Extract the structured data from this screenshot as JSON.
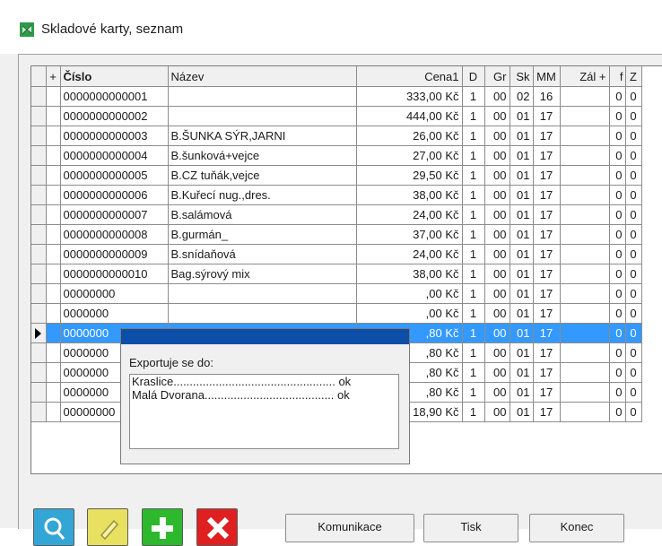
{
  "window": {
    "title": "Skladové karty, seznam",
    "icon": "stock-list-icon"
  },
  "grid": {
    "columns": {
      "plus": "+",
      "cislo": "Číslo",
      "nazev": "Název",
      "cena1": "Cena1",
      "d": "D",
      "gr": "Gr",
      "sk": "Sk",
      "mm": "MM",
      "zal": "Zál +",
      "f": "f",
      "z": "Z"
    },
    "rows": [
      {
        "cislo": "0000000000001",
        "nazev": "",
        "cena": "333,00 Kč",
        "d": "1",
        "gr": "00",
        "sk": "02",
        "mm": "16",
        "zal": "",
        "f": "0",
        "z": "0"
      },
      {
        "cislo": "0000000000002",
        "nazev": "",
        "cena": "444,00 Kč",
        "d": "1",
        "gr": "00",
        "sk": "01",
        "mm": "17",
        "zal": "",
        "f": "0",
        "z": "0"
      },
      {
        "cislo": "0000000000003",
        "nazev": "B.ŠUNKA SÝR,JARNI",
        "cena": "26,00 Kč",
        "d": "1",
        "gr": "00",
        "sk": "01",
        "mm": "17",
        "zal": "",
        "f": "0",
        "z": "0"
      },
      {
        "cislo": "0000000000004",
        "nazev": "B.šunková+vejce",
        "cena": "27,00 Kč",
        "d": "1",
        "gr": "00",
        "sk": "01",
        "mm": "17",
        "zal": "",
        "f": "0",
        "z": "0"
      },
      {
        "cislo": "0000000000005",
        "nazev": "B.CZ tuňák,vejce",
        "cena": "29,50 Kč",
        "d": "1",
        "gr": "00",
        "sk": "01",
        "mm": "17",
        "zal": "",
        "f": "0",
        "z": "0"
      },
      {
        "cislo": "0000000000006",
        "nazev": "B.Kuřecí nug.,dres.",
        "cena": "38,00 Kč",
        "d": "1",
        "gr": "00",
        "sk": "01",
        "mm": "17",
        "zal": "",
        "f": "0",
        "z": "0"
      },
      {
        "cislo": "0000000000007",
        "nazev": "B.salámová",
        "cena": "24,00 Kč",
        "d": "1",
        "gr": "00",
        "sk": "01",
        "mm": "17",
        "zal": "",
        "f": "0",
        "z": "0"
      },
      {
        "cislo": "0000000000008",
        "nazev": "B.gurmán_",
        "cena": "37,00 Kč",
        "d": "1",
        "gr": "00",
        "sk": "01",
        "mm": "17",
        "zal": "",
        "f": "0",
        "z": "0"
      },
      {
        "cislo": "0000000000009",
        "nazev": "B.snídaňová",
        "cena": "24,00 Kč",
        "d": "1",
        "gr": "00",
        "sk": "01",
        "mm": "17",
        "zal": "",
        "f": "0",
        "z": "0"
      },
      {
        "cislo": "0000000000010",
        "nazev": "Bag.sýrový mix",
        "cena": "38,00 Kč",
        "d": "1",
        "gr": "00",
        "sk": "01",
        "mm": "17",
        "zal": "",
        "f": "0",
        "z": "0"
      },
      {
        "cislo": "00000000",
        "nazev": "",
        "cena": ",00 Kč",
        "d": "1",
        "gr": "00",
        "sk": "01",
        "mm": "17",
        "zal": "",
        "f": "0",
        "z": "0"
      },
      {
        "cislo": "0000000",
        "nazev": "",
        "cena": ",00 Kč",
        "d": "1",
        "gr": "00",
        "sk": "01",
        "mm": "17",
        "zal": "",
        "f": "0",
        "z": "0"
      },
      {
        "cislo": "0000000",
        "nazev": "",
        "cena": ",80 Kč",
        "d": "1",
        "gr": "00",
        "sk": "01",
        "mm": "17",
        "zal": "",
        "f": "0",
        "z": "0"
      },
      {
        "cislo": "0000000",
        "nazev": "",
        "cena": ",80 Kč",
        "d": "1",
        "gr": "00",
        "sk": "01",
        "mm": "17",
        "zal": "",
        "f": "0",
        "z": "0"
      },
      {
        "cislo": "0000000",
        "nazev": "",
        "cena": ",80 Kč",
        "d": "1",
        "gr": "00",
        "sk": "01",
        "mm": "17",
        "zal": "",
        "f": "0",
        "z": "0"
      },
      {
        "cislo": "0000000",
        "nazev": "",
        "cena": ",80 Kč",
        "d": "1",
        "gr": "00",
        "sk": "01",
        "mm": "17",
        "zal": "",
        "f": "0",
        "z": "0"
      },
      {
        "cislo": "00000000",
        "nazev": "",
        "cena": "18,90 Kč",
        "d": "1",
        "gr": "00",
        "sk": "01",
        "mm": "17",
        "zal": "",
        "f": "0",
        "z": "0"
      }
    ]
  },
  "export_dialog": {
    "label": "Exportuje se do:",
    "lines": [
      "Kraslice.................................................. ok",
      "Malá Dvorana........................................ ok"
    ]
  },
  "toolbar": {
    "icons": [
      "search-icon",
      "edit-icon",
      "add-icon",
      "delete-icon"
    ],
    "colors": {
      "search": "#33a6d6",
      "edit": "#e8e060",
      "add": "#2eb82e",
      "delete": "#e02020"
    },
    "buttons": {
      "communication": "Komunikace",
      "print": "Tisk",
      "end": "Konec"
    }
  },
  "colors": {
    "selection": "#3399ff",
    "dialog_title": "#0d4ea8"
  }
}
